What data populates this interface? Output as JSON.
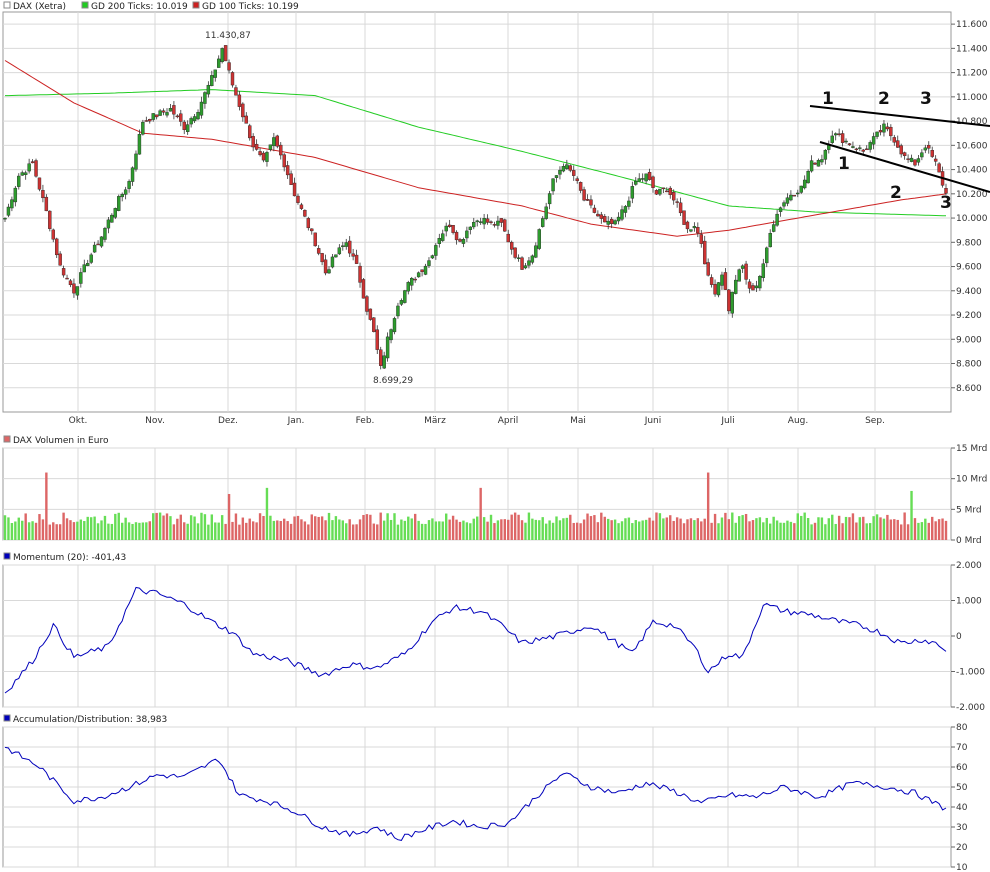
{
  "colors": {
    "sma200": "#22cc22",
    "sma100": "#cc2222",
    "up": "#2e9b2e",
    "down": "#cc3333",
    "vol_up": "#66dd55",
    "vol_down": "#dd6666",
    "ind": "#0000bb",
    "grid": "#d9d9d9",
    "frame": "#999999",
    "trendline": "#000000"
  },
  "legend": {
    "price": [
      {
        "label": "DAX (Xetra)",
        "color": "#ffffff"
      },
      {
        "label": "GD 200 Ticks: 10.019",
        "color": "#22cc22"
      },
      {
        "label": "GD 100 Ticks: 10.199",
        "color": "#cc2222"
      }
    ],
    "volume": {
      "label": "DAX Volumen in Euro",
      "color": "#dd6666"
    },
    "momentum": {
      "label": "Momentum (20): -401,43",
      "color": "#0000bb"
    },
    "ad": {
      "label": "Accumulation/Distribution: 38,983",
      "color": "#0000bb"
    }
  },
  "chart_data": [
    {
      "type": "candlestick",
      "panel": "price",
      "x_labels": [
        "Okt.",
        "Nov.",
        "Dez.",
        "Jan.",
        "Feb.",
        "März",
        "April",
        "Mai",
        "Juni",
        "Juli",
        "Aug.",
        "Sep."
      ],
      "y_ticks": [
        "8.600",
        "8.800",
        "9.000",
        "9.200",
        "9.400",
        "9.600",
        "9.800",
        "10.000",
        "10.200",
        "10.400",
        "10.600",
        "10.800",
        "11.000",
        "11.200",
        "11.400",
        "11.600"
      ],
      "ylim": [
        8400,
        11700
      ],
      "annotations": {
        "high": "11.430,87",
        "low": "8.699,29",
        "labels": [
          "1",
          "2",
          "3",
          "1",
          "2",
          "3"
        ]
      },
      "anchors_close": [
        [
          0,
          10000
        ],
        [
          4,
          10350
        ],
        [
          8,
          10450
        ],
        [
          12,
          10050
        ],
        [
          16,
          9600
        ],
        [
          20,
          9400
        ],
        [
          24,
          9650
        ],
        [
          28,
          9850
        ],
        [
          32,
          10100
        ],
        [
          36,
          10300
        ],
        [
          40,
          10800
        ],
        [
          44,
          10850
        ],
        [
          48,
          10900
        ],
        [
          52,
          10750
        ],
        [
          56,
          10900
        ],
        [
          60,
          11150
        ],
        [
          63,
          11400
        ],
        [
          66,
          11100
        ],
        [
          69,
          10850
        ],
        [
          72,
          10600
        ],
        [
          75,
          10450
        ],
        [
          78,
          10650
        ],
        [
          81,
          10450
        ],
        [
          84,
          10200
        ],
        [
          87,
          10000
        ],
        [
          90,
          9800
        ],
        [
          93,
          9550
        ],
        [
          96,
          9700
        ],
        [
          99,
          9800
        ],
        [
          102,
          9600
        ],
        [
          105,
          9250
        ],
        [
          107,
          9050
        ],
        [
          109,
          8760
        ],
        [
          111,
          9000
        ],
        [
          114,
          9300
        ],
        [
          117,
          9450
        ],
        [
          120,
          9550
        ],
        [
          123,
          9650
        ],
        [
          126,
          9850
        ],
        [
          129,
          9950
        ],
        [
          132,
          9800
        ],
        [
          135,
          9950
        ],
        [
          138,
          10000
        ],
        [
          141,
          9950
        ],
        [
          144,
          9950
        ],
        [
          147,
          9750
        ],
        [
          150,
          9600
        ],
        [
          153,
          9700
        ],
        [
          156,
          10000
        ],
        [
          159,
          10300
        ],
        [
          162,
          10450
        ],
        [
          165,
          10350
        ],
        [
          168,
          10150
        ],
        [
          171,
          10050
        ],
        [
          174,
          9950
        ],
        [
          177,
          9950
        ],
        [
          180,
          10100
        ],
        [
          183,
          10300
        ],
        [
          186,
          10350
        ],
        [
          189,
          10200
        ],
        [
          192,
          10250
        ],
        [
          195,
          10100
        ],
        [
          198,
          9900
        ],
        [
          200,
          9950
        ],
        [
          202,
          9800
        ],
        [
          204,
          9500
        ],
        [
          206,
          9400
        ],
        [
          208,
          9550
        ],
        [
          210,
          9250
        ],
        [
          212,
          9500
        ],
        [
          214,
          9600
        ],
        [
          216,
          9400
        ],
        [
          218,
          9450
        ],
        [
          220,
          9600
        ],
        [
          222,
          9900
        ],
        [
          225,
          10100
        ],
        [
          228,
          10200
        ],
        [
          231,
          10250
        ],
        [
          234,
          10450
        ],
        [
          237,
          10500
        ],
        [
          240,
          10700
        ],
        [
          243,
          10650
        ],
        [
          246,
          10600
        ],
        [
          249,
          10550
        ],
        [
          252,
          10650
        ],
        [
          255,
          10750
        ],
        [
          258,
          10650
        ],
        [
          261,
          10500
        ],
        [
          264,
          10450
        ],
        [
          267,
          10600
        ],
        [
          270,
          10450
        ],
        [
          273,
          10200
        ]
      ],
      "sma200": [
        [
          0,
          11010
        ],
        [
          30,
          11030
        ],
        [
          60,
          11060
        ],
        [
          90,
          11010
        ],
        [
          120,
          10750
        ],
        [
          150,
          10550
        ],
        [
          180,
          10330
        ],
        [
          210,
          10100
        ],
        [
          235,
          10050
        ],
        [
          273,
          10019
        ]
      ],
      "sma100": [
        [
          0,
          11300
        ],
        [
          20,
          10950
        ],
        [
          40,
          10700
        ],
        [
          60,
          10650
        ],
        [
          90,
          10500
        ],
        [
          120,
          10250
        ],
        [
          150,
          10100
        ],
        [
          170,
          9950
        ],
        [
          195,
          9850
        ],
        [
          210,
          9900
        ],
        [
          230,
          10000
        ],
        [
          260,
          10150
        ],
        [
          273,
          10199
        ]
      ]
    },
    {
      "type": "bar",
      "panel": "volume",
      "y_ticks": [
        "15 Mrd",
        "10 Mrd",
        "5 Mrd",
        "0 Mrd"
      ],
      "ylim": [
        0,
        15
      ]
    },
    {
      "type": "line",
      "panel": "momentum",
      "y_ticks": [
        "2.000",
        "1.000",
        "0",
        "-1.000",
        "-2.000"
      ],
      "ylim": [
        -2000,
        2000
      ],
      "anchors": [
        [
          0,
          -1600
        ],
        [
          8,
          -700
        ],
        [
          14,
          300
        ],
        [
          20,
          -600
        ],
        [
          30,
          -300
        ],
        [
          38,
          1300
        ],
        [
          44,
          1200
        ],
        [
          52,
          900
        ],
        [
          60,
          400
        ],
        [
          66,
          100
        ],
        [
          72,
          -500
        ],
        [
          82,
          -700
        ],
        [
          92,
          -1100
        ],
        [
          100,
          -800
        ],
        [
          108,
          -900
        ],
        [
          116,
          -500
        ],
        [
          124,
          400
        ],
        [
          130,
          800
        ],
        [
          138,
          700
        ],
        [
          144,
          300
        ],
        [
          150,
          -200
        ],
        [
          160,
          0
        ],
        [
          170,
          300
        ],
        [
          176,
          -100
        ],
        [
          182,
          -500
        ],
        [
          188,
          400
        ],
        [
          194,
          300
        ],
        [
          200,
          -300
        ],
        [
          204,
          -1000
        ],
        [
          210,
          -500
        ],
        [
          214,
          -600
        ],
        [
          220,
          900
        ],
        [
          226,
          700
        ],
        [
          234,
          600
        ],
        [
          242,
          400
        ],
        [
          248,
          300
        ],
        [
          254,
          100
        ],
        [
          260,
          -200
        ],
        [
          266,
          -100
        ],
        [
          270,
          -200
        ],
        [
          273,
          -401
        ]
      ]
    },
    {
      "type": "line",
      "panel": "ad",
      "y_ticks": [
        "80",
        "70",
        "60",
        "50",
        "40",
        "30",
        "20",
        "10"
      ],
      "ylim": [
        10,
        80
      ],
      "anchors": [
        [
          0,
          70
        ],
        [
          10,
          60
        ],
        [
          20,
          43
        ],
        [
          28,
          45
        ],
        [
          36,
          50
        ],
        [
          44,
          56
        ],
        [
          52,
          55
        ],
        [
          62,
          64
        ],
        [
          68,
          46
        ],
        [
          76,
          43
        ],
        [
          84,
          38
        ],
        [
          92,
          30
        ],
        [
          100,
          26
        ],
        [
          108,
          30
        ],
        [
          114,
          24
        ],
        [
          122,
          29
        ],
        [
          130,
          33
        ],
        [
          138,
          30
        ],
        [
          146,
          32
        ],
        [
          154,
          45
        ],
        [
          162,
          57
        ],
        [
          170,
          50
        ],
        [
          178,
          47
        ],
        [
          186,
          52
        ],
        [
          194,
          48
        ],
        [
          202,
          42
        ],
        [
          210,
          46
        ],
        [
          218,
          45
        ],
        [
          226,
          50
        ],
        [
          236,
          45
        ],
        [
          246,
          52
        ],
        [
          256,
          50
        ],
        [
          264,
          47
        ],
        [
          273,
          39
        ]
      ]
    }
  ]
}
